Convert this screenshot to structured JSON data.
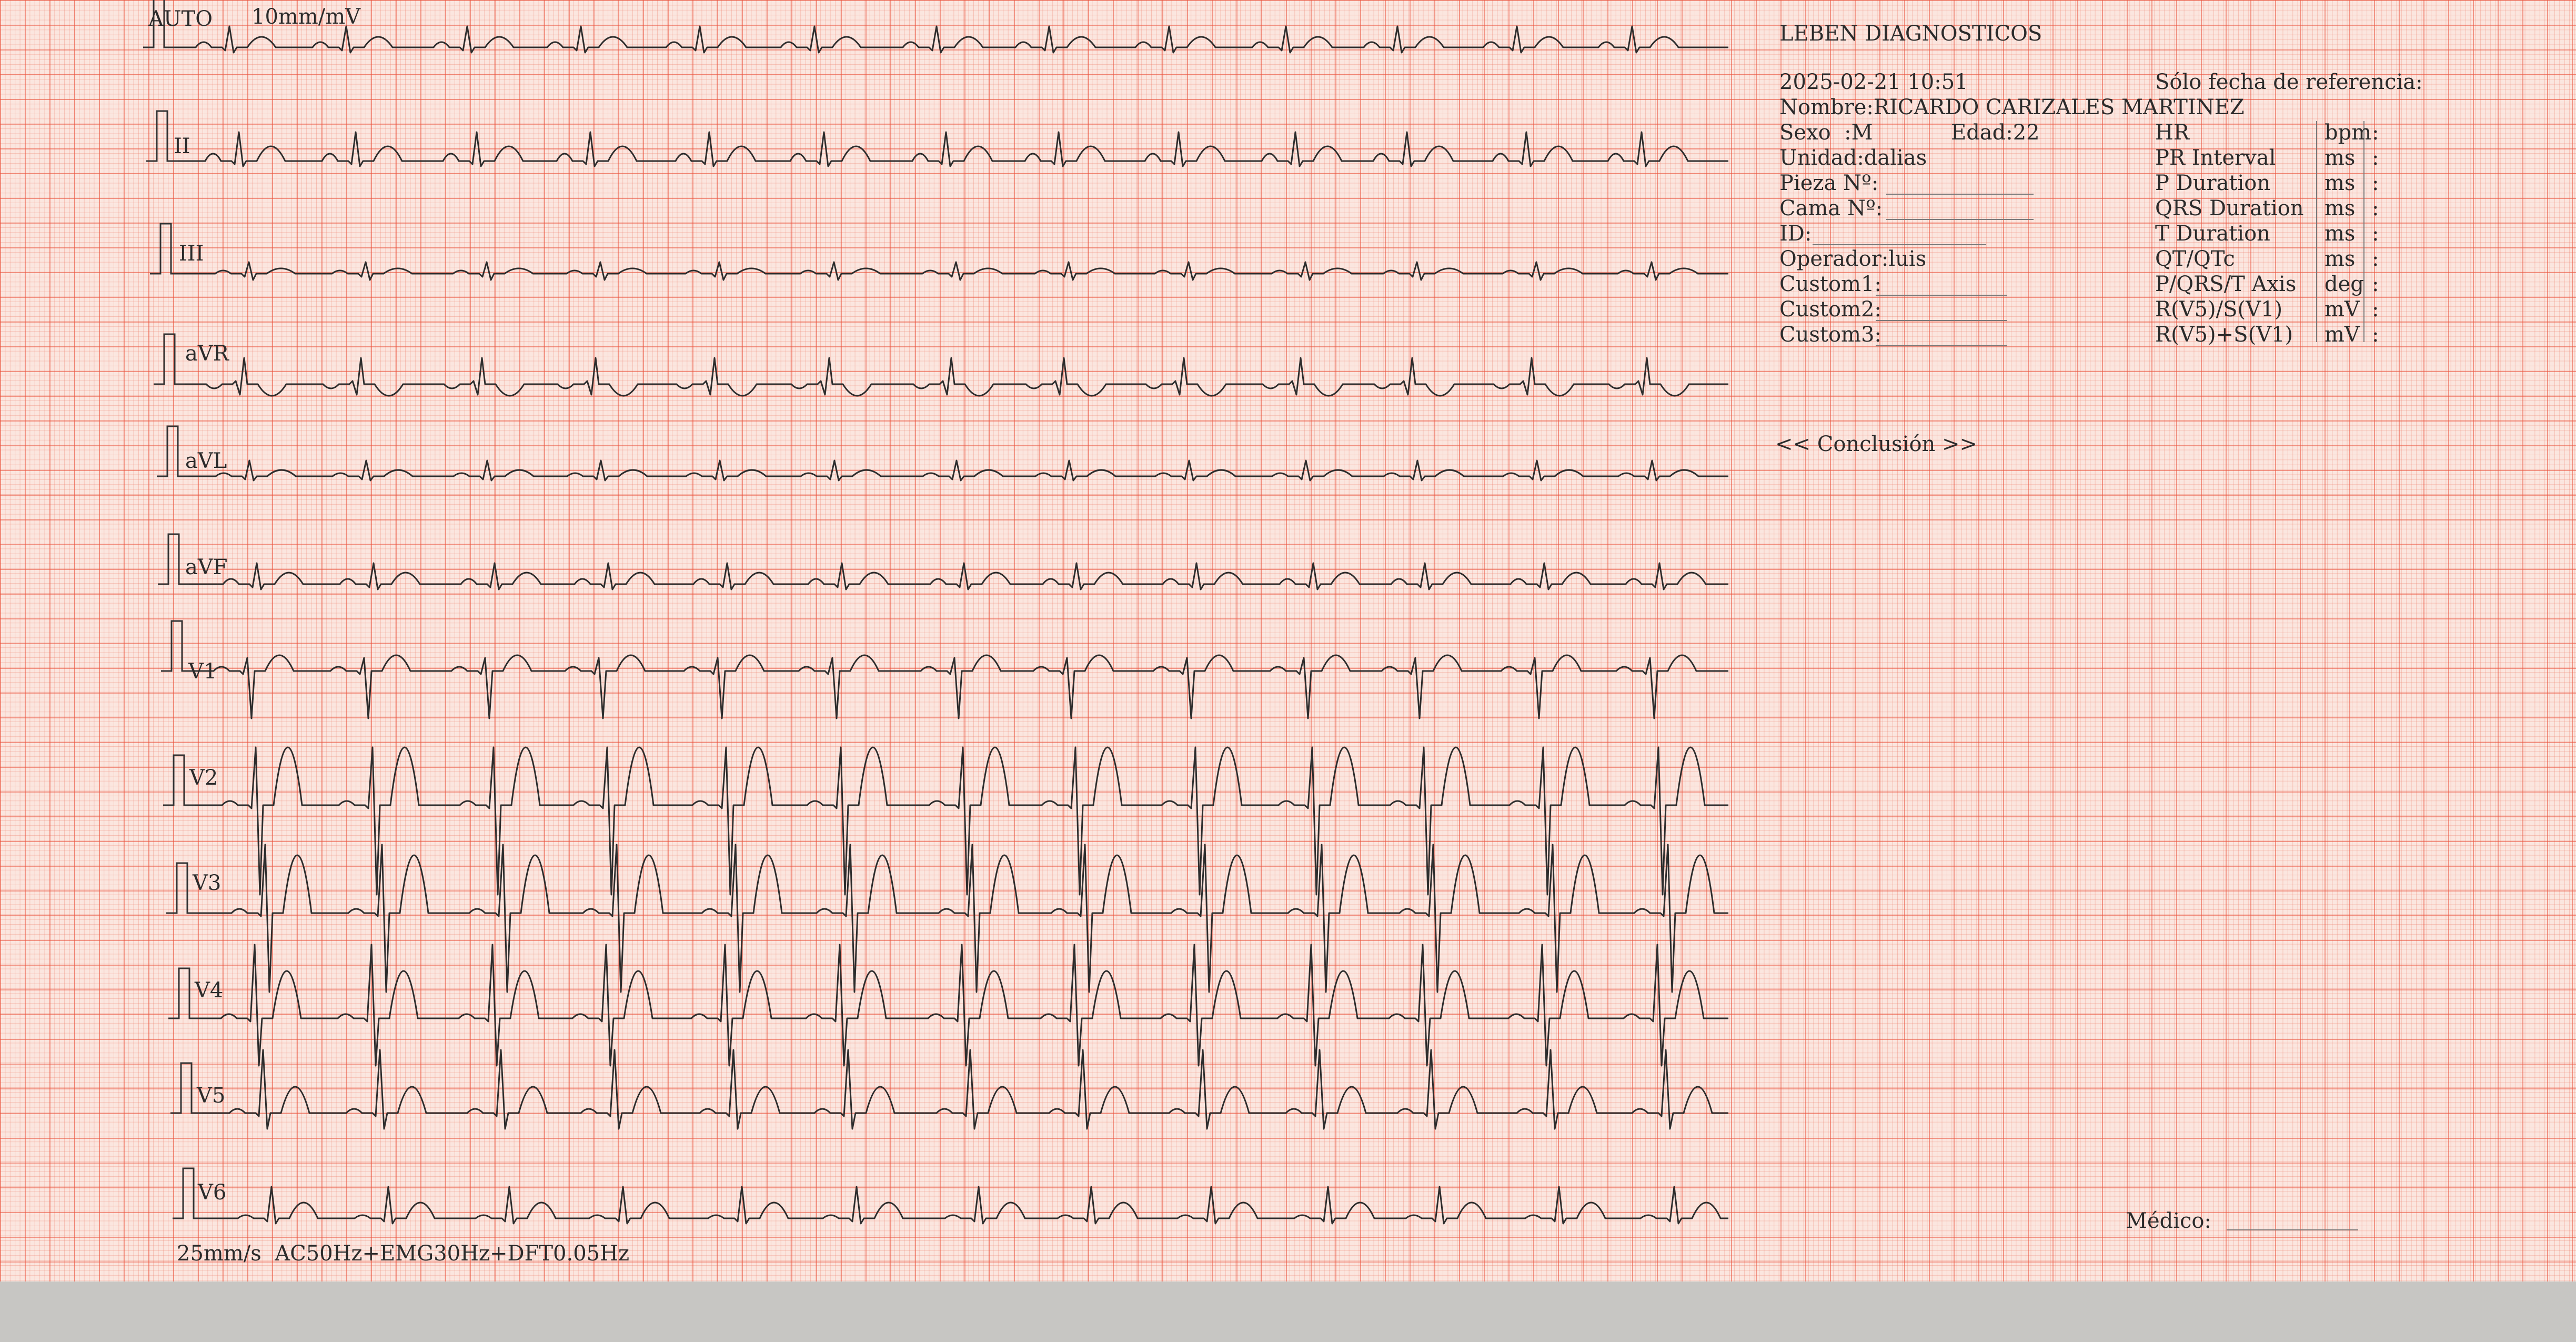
{
  "header": {
    "auto_label": "AUTO",
    "gain": "10mm/mV",
    "footer_settings": "25mm/s  AC50Hz+EMG30Hz+DFT0.05Hz"
  },
  "leads": [
    "",
    "II",
    "III",
    "aVR",
    "aVL",
    "aVF",
    "V1",
    "V2",
    "V3",
    "V4",
    "V5",
    "V6"
  ],
  "patient": {
    "institution": "LEBEN DIAGNOSTICOS",
    "datetime": "2025-02-21 10:51",
    "reference_note": "Sólo fecha de referencia:",
    "name": "Nombre:RICARDO CARIZALES MARTINEZ",
    "sex": "Sexo  :M",
    "age": "Edad:22",
    "unit": "Unidad:dalias",
    "room": "Pieza Nº:",
    "bed": "Cama Nº:",
    "id": "ID:",
    "operator": "Operador:luis",
    "custom1": "Custom1:",
    "custom2": "Custom2:",
    "custom3": "Custom3:"
  },
  "measurements": [
    {
      "label": "HR",
      "unit": "bpm"
    },
    {
      "label": "PR Interval",
      "unit": "ms"
    },
    {
      "label": "P Duration",
      "unit": "ms"
    },
    {
      "label": "QRS Duration",
      "unit": "ms"
    },
    {
      "label": "T Duration",
      "unit": "ms"
    },
    {
      "label": "QT/QTc",
      "unit": "ms"
    },
    {
      "label": "P/QRS/T Axis",
      "unit": "deg"
    },
    {
      "label": "R(V5)/S(V1)",
      "unit": "mV"
    },
    {
      "label": "R(V5)+S(V1)",
      "unit": "mV"
    }
  ],
  "conclusion": "<< Conclusión >>",
  "doctor": "Médico:"
}
